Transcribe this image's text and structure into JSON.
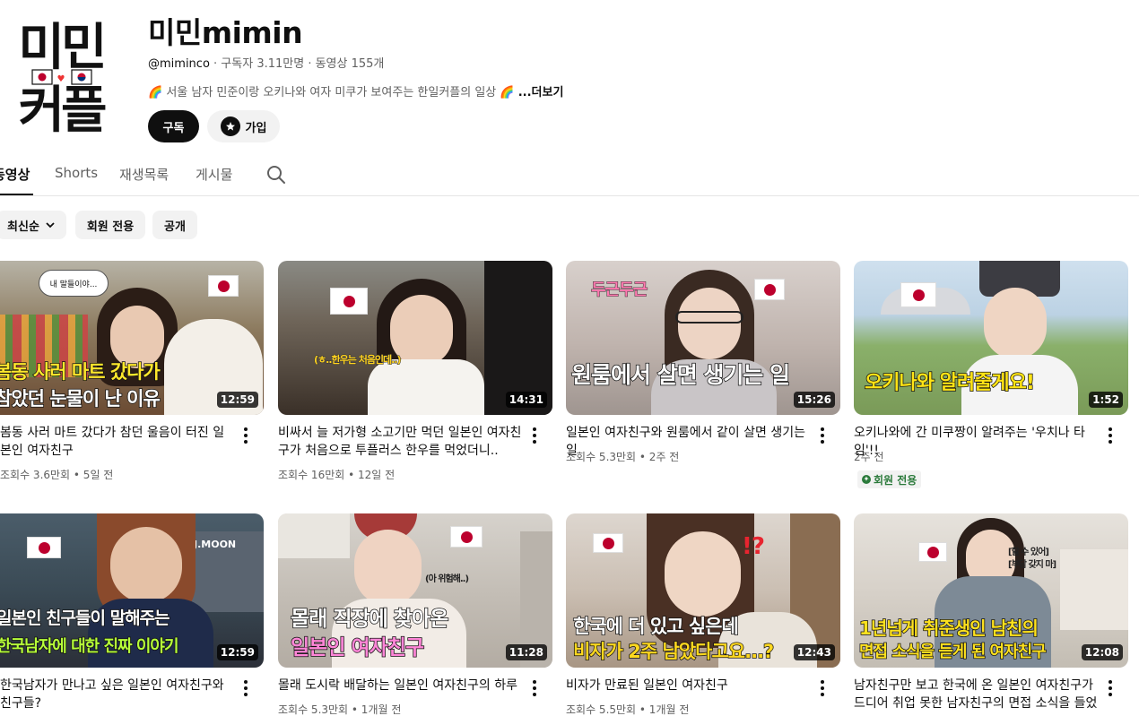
{
  "channel": {
    "logo_top": "미민",
    "logo_bottom": "커플",
    "name": "미민mimin",
    "handle": "@miminco",
    "meta": " · 구독자 3.11만명 · 동영상 155개",
    "description": "🌈 서울 남자 민준이랑 오키나와 여자 미쿠가 보여주는 한일커플의 일상 🌈",
    "more": "...더보기",
    "subscribe_label": "구독",
    "join_label": "가입"
  },
  "tabs": [
    "동영상",
    "Shorts",
    "재생목록",
    "게시물"
  ],
  "chips": {
    "sort": "최신순",
    "members": "회원 전용",
    "public": "공개"
  },
  "videos": [
    {
      "title": "봄동 사러 마트 갔다가 참던 울음이 터진 일본인 여자친구",
      "stats": "조회수 3.6만회 • 5일 전",
      "duration": "12:59",
      "caption1": "봄동 사러 마트 갔다가",
      "caption2": "참았던 눈물이 난 이유",
      "bubble": "내 말들이야..."
    },
    {
      "title": "비싸서 늘 저가형 소고기만 먹던 일본인 여자친구가 처음으로 투플러스 한우를 먹었더니..",
      "stats": "조회수 16만회 • 12일 전",
      "duration": "14:31",
      "caption1": "(ㅎ..한우는 처음인데..)"
    },
    {
      "title": "일본인 여자친구와 원룸에서 같이 살면 생기는 일",
      "stats": "조회수 5.3만회 • 2주 전",
      "duration": "15:26",
      "caption1": "원룸에서 살면 생기는 일",
      "caption2": "두근두근"
    },
    {
      "title": "오키나와에 간 미쿠짱이 알려주는 '우치나 타임'!!",
      "stats": "2주 전",
      "duration": "1:52",
      "caption1": "오키나와 알려줄게요!",
      "badge": "회원 전용"
    },
    {
      "title": "한국남자가 만나고 싶은 일본인 여자친구와 친구들?",
      "stats": "",
      "duration": "12:59",
      "caption1": "일본인 친구들이 말해주는",
      "caption2": "한국남자에 대한 진짜 이야기",
      "sign": "J.MOON"
    },
    {
      "title": "몰래 도시락 배달하는 일본인 여자친구의 하루",
      "stats": "조회수 5.3만회 • 1개월 전",
      "duration": "11:28",
      "caption1": "몰래 직장에 찾아온",
      "caption2": "일본인 여자친구",
      "caption3": "(아 위험해..)"
    },
    {
      "title": "비자가 만료된 일본인 여자친구",
      "stats": "조회수 5.5만회 • 1개월 전",
      "duration": "12:43",
      "caption1": "한국에 더 있고 싶은데",
      "caption2": "비자가 2주 남았다고요...?",
      "caption3": "!?"
    },
    {
      "title": "남자친구만 보고 한국에 온 일본인 여자친구가 드디어 취업 못한 남자친구의 면접 소식을 들었더...",
      "stats": "",
      "duration": "12:08",
      "caption1": "1년넘게 취준생인 남친의",
      "caption2": "면접 소식을 듣게 된 여자친구",
      "caption3": "[할 수 있어]",
      "caption4": "[부담 갖지 마]"
    }
  ]
}
